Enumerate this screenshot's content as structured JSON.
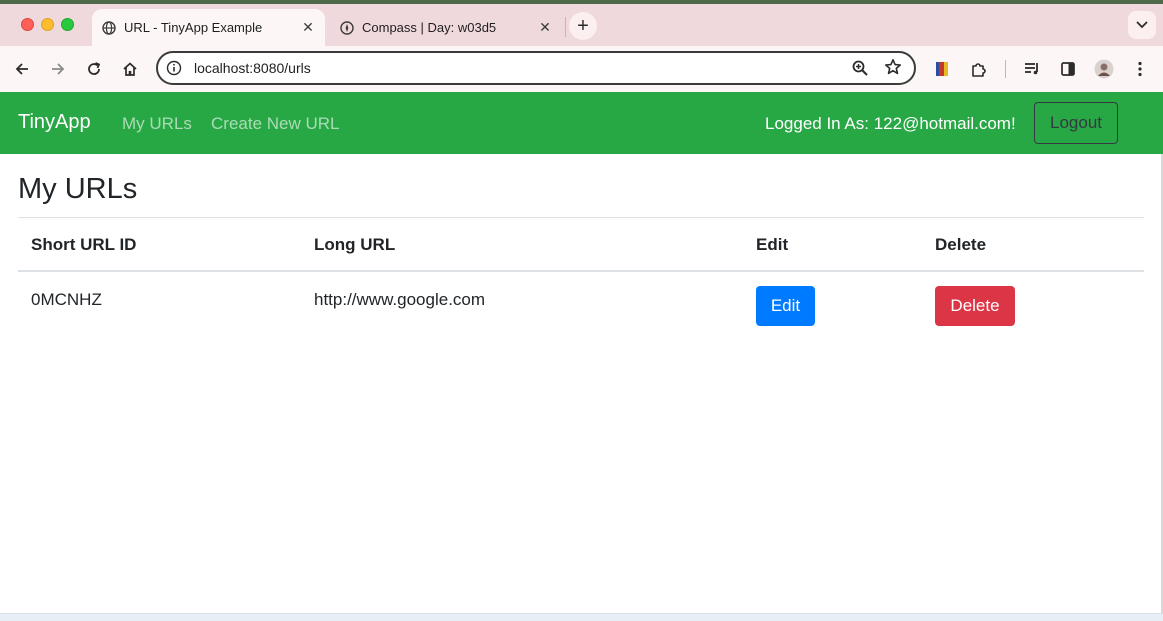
{
  "browser": {
    "tabs": [
      {
        "title": "URL - TinyApp Example",
        "active": true,
        "icon": "globe-icon"
      },
      {
        "title": "Compass | Day: w03d5",
        "active": false,
        "icon": "compass-icon"
      }
    ],
    "address": "localhost:8080/urls"
  },
  "navbar": {
    "brand": "TinyApp",
    "links": [
      "My URLs",
      "Create New URL"
    ],
    "logged_in_text": "Logged In As: 122@hotmail.com!",
    "logout_label": "Logout",
    "background": "#28a745"
  },
  "main": {
    "title": "My URLs",
    "table": {
      "headers": [
        "Short URL ID",
        "Long URL",
        "Edit",
        "Delete"
      ],
      "rows": [
        {
          "short_id": "0MCNHZ",
          "long_url": "http://www.google.com",
          "edit_label": "Edit",
          "delete_label": "Delete"
        }
      ]
    },
    "colors": {
      "edit": "#007bff",
      "delete": "#dc3545"
    }
  }
}
